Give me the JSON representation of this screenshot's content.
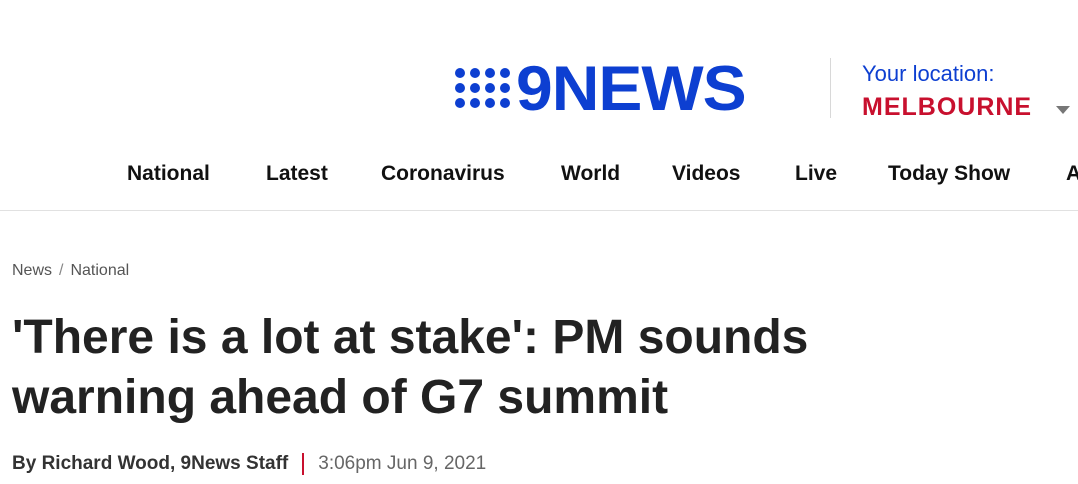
{
  "logo": {
    "text": "9NEWS"
  },
  "location": {
    "label": "Your location:",
    "value": "MELBOURNE"
  },
  "nav": [
    {
      "label": "National"
    },
    {
      "label": "Latest"
    },
    {
      "label": "Coronavirus"
    },
    {
      "label": "World"
    },
    {
      "label": "Videos"
    },
    {
      "label": "Live"
    },
    {
      "label": "Today Show"
    },
    {
      "label": "A"
    }
  ],
  "breadcrumb": [
    "News",
    "National"
  ],
  "article": {
    "headline": "'There is a lot at stake': PM sounds warning ahead of G7 summit",
    "author": "By Richard Wood, 9News Staff",
    "timestamp": "3:06pm Jun 9, 2021"
  },
  "colors": {
    "brand_blue": "#0d3fd1",
    "accent_red": "#c8102e"
  }
}
